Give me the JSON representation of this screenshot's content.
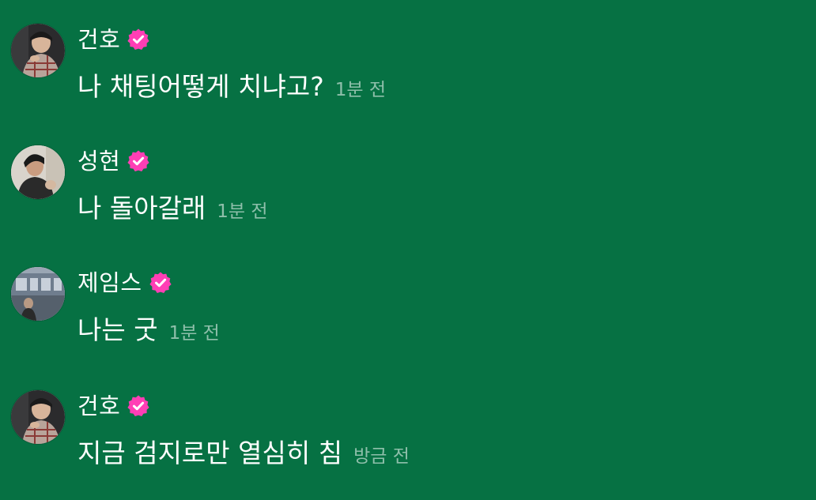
{
  "colors": {
    "background": "#067143",
    "verified_badge": "#ff3eb5",
    "timestamp": "rgba(255,255,255,0.55)"
  },
  "messages": [
    {
      "name": "건호",
      "text": "나 채팅어떻게 치냐고?",
      "time": "1분 전",
      "avatar": "avatar-kunho",
      "verified": "verified-badge-icon"
    },
    {
      "name": "성현",
      "text": "나 돌아갈래",
      "time": "1분 전",
      "avatar": "avatar-sunghyun",
      "verified": "verified-badge-icon"
    },
    {
      "name": "제임스",
      "text": "나는 굿",
      "time": "1분 전",
      "avatar": "avatar-james",
      "verified": "verified-badge-icon"
    },
    {
      "name": "건호",
      "text": "지금 검지로만 열심히 침",
      "time": "방금 전",
      "avatar": "avatar-kunho",
      "verified": "verified-badge-icon"
    }
  ]
}
